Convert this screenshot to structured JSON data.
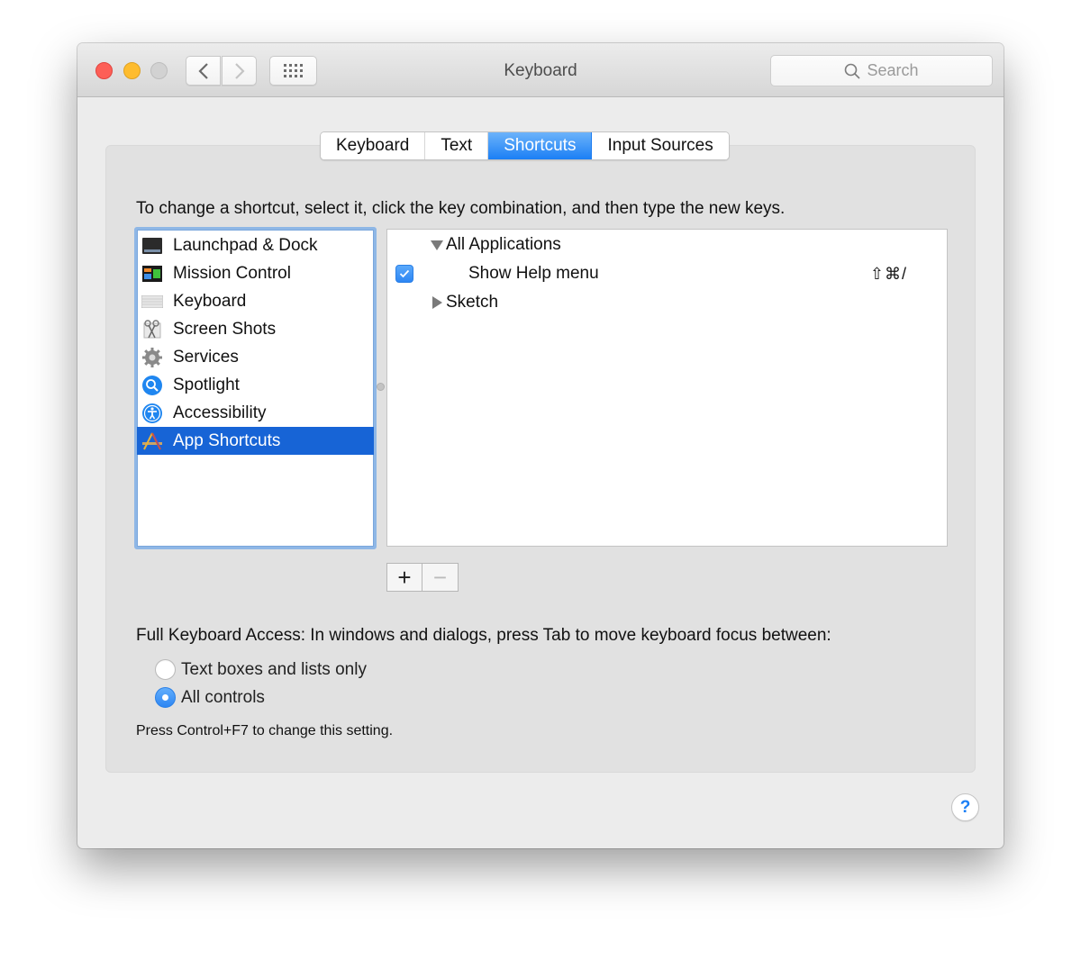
{
  "window": {
    "title": "Keyboard",
    "search_placeholder": "Search"
  },
  "toolbar": {
    "icons": [
      "close-light",
      "minimize-light",
      "zoom-light",
      "chevron-left-icon",
      "chevron-right-icon",
      "grid-icon"
    ]
  },
  "tabs": [
    {
      "label": "Keyboard",
      "active": false
    },
    {
      "label": "Text",
      "active": false
    },
    {
      "label": "Shortcuts",
      "active": true
    },
    {
      "label": "Input Sources",
      "active": false
    }
  ],
  "instruction": "To change a shortcut, select it, click the key combination, and then type the new keys.",
  "categories": [
    {
      "label": "Launchpad & Dock",
      "icon": "launchpad-dock-icon",
      "selected": false
    },
    {
      "label": "Mission Control",
      "icon": "mission-control-icon",
      "selected": false
    },
    {
      "label": "Keyboard",
      "icon": "keyboard-icon",
      "selected": false
    },
    {
      "label": "Screen Shots",
      "icon": "screenshot-icon",
      "selected": false
    },
    {
      "label": "Services",
      "icon": "gear-icon",
      "selected": false
    },
    {
      "label": "Spotlight",
      "icon": "spotlight-icon",
      "selected": false
    },
    {
      "label": "Accessibility",
      "icon": "accessibility-icon",
      "selected": false
    },
    {
      "label": "App Shortcuts",
      "icon": "app-shortcuts-icon",
      "selected": true
    }
  ],
  "shortcuts": {
    "groups": [
      {
        "label": "All Applications",
        "expanded": true
      },
      {
        "label": "Sketch",
        "expanded": false
      }
    ],
    "items": [
      {
        "label": "Show Help menu",
        "checked": true,
        "keys": "⇧⌘/"
      }
    ]
  },
  "list_buttons": {
    "add": "+",
    "remove": "−"
  },
  "full_keyboard_access": {
    "label": "Full Keyboard Access: In windows and dialogs, press Tab to move keyboard focus between:",
    "options": [
      {
        "label": "Text boxes and lists only",
        "selected": false
      },
      {
        "label": "All controls",
        "selected": true
      }
    ],
    "note": "Press Control+F7 to change this setting."
  },
  "help": {
    "label": "?"
  },
  "colors": {
    "accent": "#1b7ff5",
    "selection": "#1764d6",
    "close": "#fd5f57",
    "minimize": "#febc2e",
    "zoom_disabled": "#d2d2d2"
  }
}
